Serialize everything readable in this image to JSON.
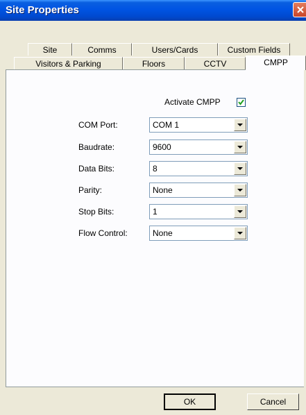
{
  "window": {
    "title": "Site Properties"
  },
  "tabs": {
    "row1": [
      "Site",
      "Comms",
      "Users/Cards",
      "Custom Fields"
    ],
    "row2": [
      "Visitors & Parking",
      "Floors",
      "CCTV",
      "CMPP"
    ],
    "active": "CMPP"
  },
  "cmpp": {
    "activate_label": "Activate CMPP",
    "activate_checked": true,
    "fields": [
      {
        "label": "COM Port:",
        "value": "COM 1"
      },
      {
        "label": "Baudrate:",
        "value": "9600"
      },
      {
        "label": "Data Bits:",
        "value": "8"
      },
      {
        "label": "Parity:",
        "value": "None"
      },
      {
        "label": "Stop Bits:",
        "value": "1"
      },
      {
        "label": "Flow Control:",
        "value": "None"
      }
    ]
  },
  "buttons": {
    "ok": "OK",
    "cancel": "Cancel"
  },
  "colors": {
    "titlebar": "#0054e3",
    "dialog_bg": "#ece9d8",
    "close": "#c8452a"
  },
  "icons": {
    "close": "close-icon",
    "dropdown": "chevron-down-icon",
    "checkbox": "checkmark-icon"
  }
}
